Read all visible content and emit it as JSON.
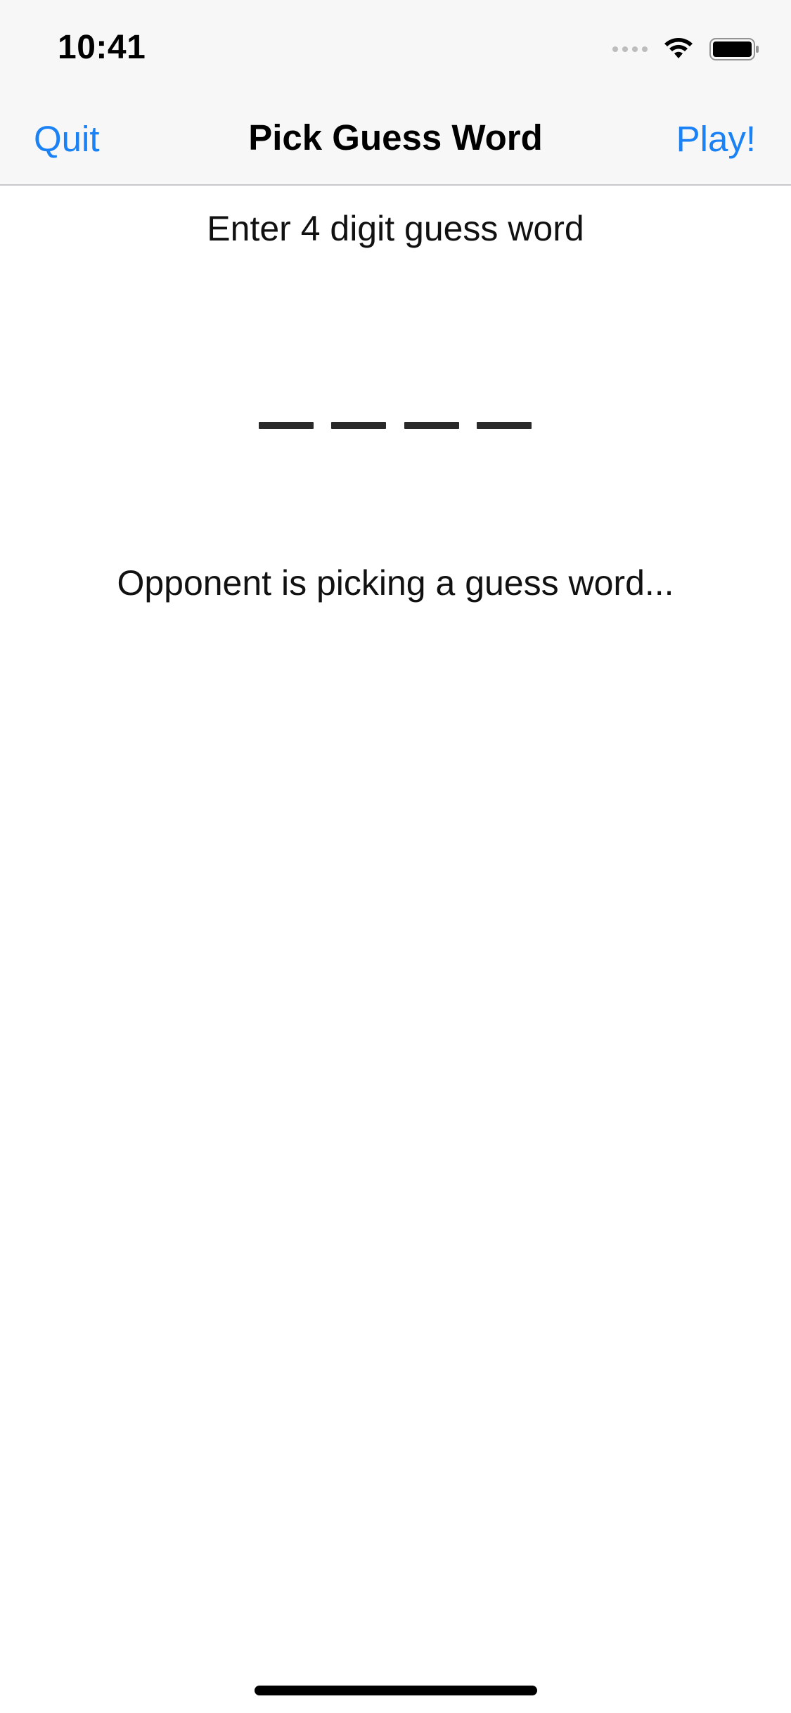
{
  "status_bar": {
    "time": "10:41"
  },
  "nav_bar": {
    "left_button": "Quit",
    "title": "Pick Guess Word",
    "right_button": "Play!"
  },
  "main": {
    "prompt": "Enter 4 digit guess word",
    "digit_slots": [
      "",
      "",
      "",
      ""
    ],
    "status_message": "Opponent is picking a guess word..."
  },
  "colors": {
    "accent": "#1a82f5",
    "nav_background": "#f7f7f7",
    "text": "#111111"
  },
  "icons": [
    "signal-icon",
    "wifi-icon",
    "battery-icon"
  ]
}
